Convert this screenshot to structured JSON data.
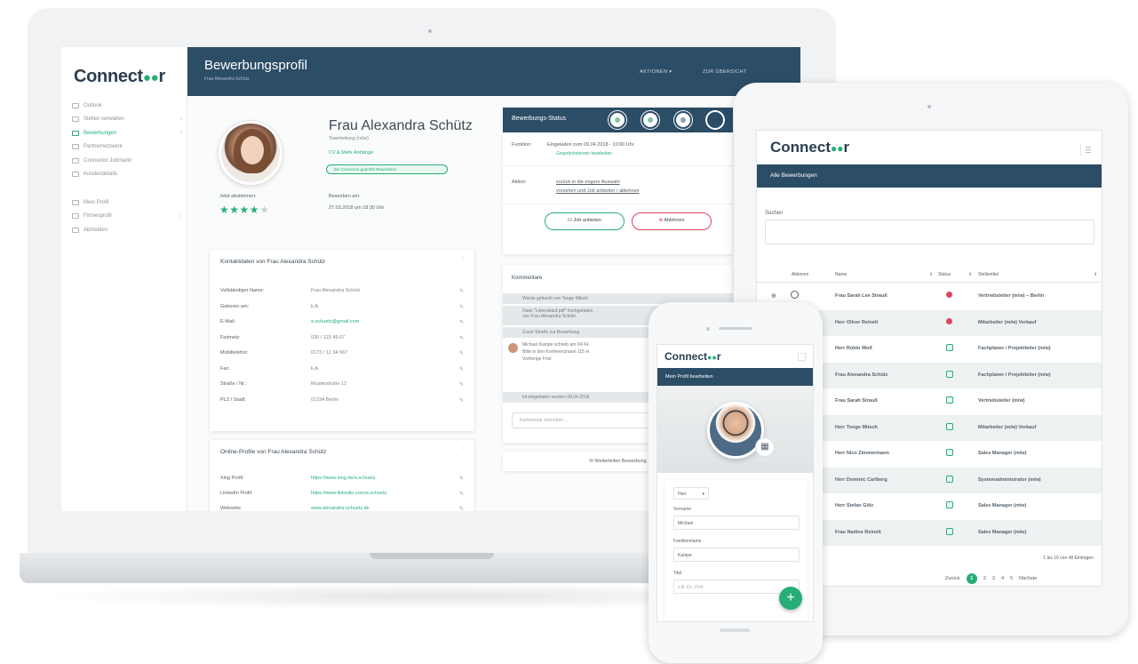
{
  "laptop": {
    "logo": "Connect",
    "logo_tail": "r",
    "nav": [
      {
        "label": "Outlook",
        "icon": "home-icon",
        "active": false
      },
      {
        "label": "Stellen verwalten",
        "icon": "briefcase-icon",
        "active": false
      },
      {
        "label": "Bewerbungen",
        "icon": "users-icon",
        "active": true
      },
      {
        "label": "Partnernetzwerk",
        "icon": "network-icon",
        "active": false
      },
      {
        "label": "Connector Jobmarkt",
        "icon": "market-icon",
        "active": false
      },
      {
        "label": "Kundendetails",
        "icon": "calendar-icon",
        "active": false
      },
      {
        "label": "Mein Profil",
        "icon": "profile-icon",
        "active": false
      },
      {
        "label": "Firmenprofil",
        "icon": "building-icon",
        "active": false
      },
      {
        "label": "Abmelden",
        "icon": "logout-icon",
        "active": false
      }
    ],
    "header": {
      "title": "Bewerbungsprofil",
      "subtitle": "Frau Alexandra Schütz",
      "actions": "AKTIONEN ▾",
      "overview": "ZUR ÜBERSICHT"
    },
    "profile": {
      "name": "Frau Alexandra Schütz",
      "role": "Teamleitung (m/w)",
      "link": "CV & Mehr Anhänge",
      "badge": "Bei Connector geprüfte Bewerberin",
      "rating_label": "Jetzt abstimmen:",
      "rating": 4,
      "rating_max": 5,
      "applied_label": "Beworben am:",
      "applied_value": "27.03.2018 um 18:30 Uhr"
    },
    "contact_card": {
      "title": "Kontaktdaten von Frau Alexandra Schütz",
      "rows": [
        {
          "k": "Vollständiger Name:",
          "v": "Frau Alexandra Schütz",
          "green": false
        },
        {
          "k": "Geboren am:",
          "v": "k.A.",
          "green": false
        },
        {
          "k": "E-Mail:",
          "v": "a.schuetz@gmail.com",
          "green": true
        },
        {
          "k": "Festnetz:",
          "v": "030 / 123 45 67",
          "green": false
        },
        {
          "k": "Mobiltelefon:",
          "v": "0173 / 12 34 567",
          "green": false
        },
        {
          "k": "Fax:",
          "v": "k.A.",
          "green": false
        },
        {
          "k": "Straße / Nr.:",
          "v": "Musterstraße 12",
          "green": false
        },
        {
          "k": "PLZ / Stadt:",
          "v": "01234 Berlin",
          "green": false
        }
      ]
    },
    "online_card": {
      "title": "Online-Profile von Frau Alexandra Schütz",
      "rows": [
        {
          "k": "Xing Profil:",
          "v": "https://www.xing.de/a.schuetz",
          "green": true
        },
        {
          "k": "LinkedIn Profil:",
          "v": "https://www.linkedin.com/a.schuetz",
          "green": true
        },
        {
          "k": "Webseite:",
          "v": "www.alexandra-schuetz.de",
          "green": true
        }
      ]
    },
    "status": {
      "title": "Bewerbungs-Status",
      "f_label": "Funktion:",
      "f_value": "Eingeladen zum 09.04.2018 - 10:00 Uhr",
      "f_sub": "Gesprächstermin bearbeiten",
      "a_label": "Aktion:",
      "a1": "zurück in die engere Auswahl",
      "a2": "vorsehen und Job anbieten / ablehnen",
      "btn_accept": "Job anbieten",
      "btn_reject": "Ablehnen"
    },
    "comments": {
      "title": "Kommentare",
      "c1": "Wurde gebucht von Tonge Mitsch",
      "c2": "Datei \"Lebenslauf.pdf\" hochgeladen",
      "c2b": "von Frau Alexandra Schütz",
      "c3": "Zuvor Straße zur Bewerbung",
      "c4": "Michael Kampe schrieb am 04.04.",
      "c4b": "Bitte in den Konferenzraum 115 ei",
      "c4c": "Vorherige Frist",
      "c5": "Ist eingeladen worden 09.04.2018",
      "placeholder": "Kommentar schreiben ...",
      "more": "Weiterleiten Bewerbung"
    }
  },
  "tablet": {
    "logo": "Connect",
    "logo_tail": "r",
    "header": "Alle Bewerbungen",
    "search_label": "Suchen",
    "cols": {
      "actions": "Aktionen",
      "name": "Name",
      "status": "Status",
      "job": "Stellentitel"
    },
    "rows": [
      {
        "name": "Frau Sarah Lee Strauß",
        "job": "Vertriebsleiter (m/w) – Berlin",
        "status": "red"
      },
      {
        "name": "Herr Oliver Reinelt",
        "job": "Mitarbeiter (m/w) Verkauf",
        "status": "red"
      },
      {
        "name": "Herr Robin Wolf",
        "job": "Fachplaner / Projektleiter (m/w)",
        "status": "green"
      },
      {
        "name": "Frau Alexandra Schütz",
        "job": "Fachplaner / Projektleiter (m/w)",
        "status": "green"
      },
      {
        "name": "Frau Sarah Strauß",
        "job": "Vertriebsleiter (m/w)",
        "status": "green"
      },
      {
        "name": "Herr Tonge Mitsch",
        "job": "Mitarbeiter (m/w) Verkauf",
        "status": "green"
      },
      {
        "name": "Herr Nico Zimmermann",
        "job": "Sales Manager (m/w)",
        "status": "green"
      },
      {
        "name": "Herr Dominic Carlberg",
        "job": "Systemadministrator (m/w)",
        "status": "green"
      },
      {
        "name": "Herr Stefan Gölz",
        "job": "Sales Manager (m/w)",
        "status": "green"
      },
      {
        "name": "Frau Nadine Reinelt",
        "job": "Sales Manager (m/w)",
        "status": "green"
      }
    ],
    "count": "1 bis 10 von 48 Einträgen",
    "pager": {
      "prev": "Zurück",
      "pages": [
        "1",
        "2",
        "3",
        "4",
        "5"
      ],
      "next": "Nächste",
      "current": "1"
    }
  },
  "phone": {
    "logo": "Connect",
    "logo_tail": "r",
    "header": "Mein Profil bearbeiten",
    "salutation": "Herr",
    "first_label": "Vorname",
    "first_value": "Michael",
    "last_label": "Familienname",
    "last_value": "Kampe",
    "title_label": "Titel",
    "title_placeholder": "z.B. Dr., Prof.",
    "fab": "+"
  }
}
